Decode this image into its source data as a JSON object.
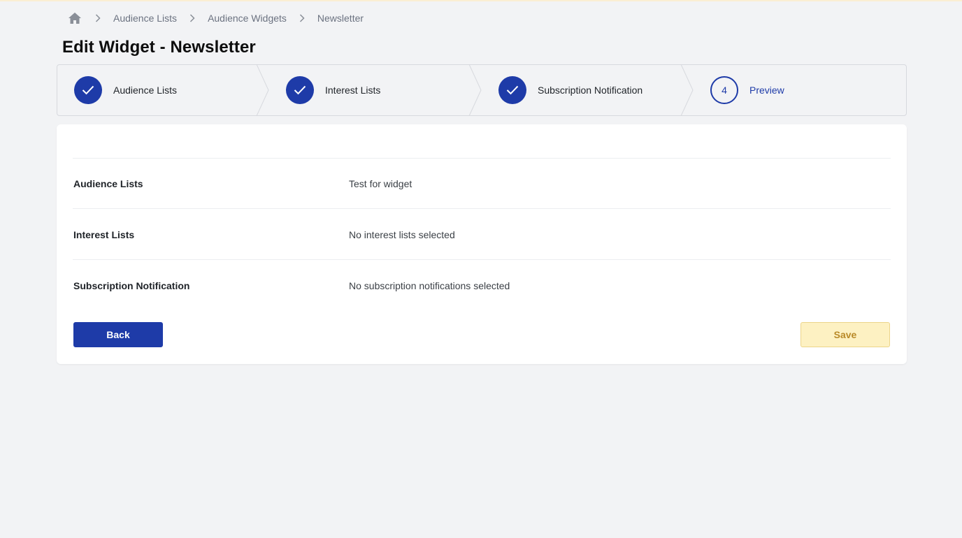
{
  "breadcrumb": {
    "home_icon": "home-icon",
    "separator_icon": "chevron-right-icon",
    "items": [
      "Audience Lists",
      "Audience Widgets"
    ],
    "current": "Newsletter"
  },
  "page": {
    "title": "Edit Widget - Newsletter"
  },
  "stepper": {
    "steps": [
      {
        "label": "Audience Lists",
        "status": "complete",
        "icon": "check-icon"
      },
      {
        "label": "Interest Lists",
        "status": "complete",
        "icon": "check-icon"
      },
      {
        "label": "Subscription Notification",
        "status": "complete",
        "icon": "check-icon"
      },
      {
        "label": "Preview",
        "status": "current",
        "number": "4"
      }
    ]
  },
  "summary": {
    "rows": [
      {
        "label": "Audience Lists",
        "value": "Test for widget"
      },
      {
        "label": "Interest Lists",
        "value": "No interest lists selected"
      },
      {
        "label": "Subscription Notification",
        "value": "No subscription notifications selected"
      }
    ]
  },
  "actions": {
    "back_label": "Back",
    "save_label": "Save"
  },
  "colors": {
    "primary": "#1e3ba8",
    "save_bg": "#fdf1c2",
    "save_text": "#b98a28",
    "page_bg": "#f2f3f5"
  }
}
